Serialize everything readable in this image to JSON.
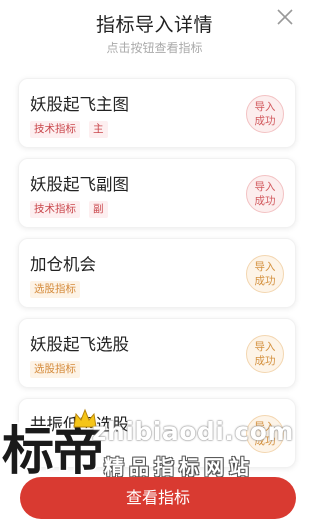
{
  "header": {
    "title": "指标导入详情",
    "subtitle": "点击按钮查看指标",
    "close_icon": "close-icon"
  },
  "items": [
    {
      "name": "妖股起飞主图",
      "tags": [
        "技术指标",
        "主"
      ],
      "tag_color": "red",
      "status": "导入成功"
    },
    {
      "name": "妖股起飞副图",
      "tags": [
        "技术指标",
        "副"
      ],
      "tag_color": "red",
      "status": "导入成功"
    },
    {
      "name": "加仓机会",
      "tags": [
        "选股指标"
      ],
      "tag_color": "orange",
      "status": "导入成功"
    },
    {
      "name": "妖股起飞选股",
      "tags": [
        "选股指标"
      ],
      "tag_color": "orange",
      "status": "导入成功"
    },
    {
      "name": "共振低吸选股",
      "tags": [],
      "tag_color": "orange",
      "status": "导入成功"
    }
  ],
  "watermark": {
    "brand": "标帝",
    "domain": "zhibiaodi.com",
    "slogan": "精品指标网站"
  },
  "footer": {
    "button_label": "查看指标"
  },
  "colors": {
    "accent": "#d93a31",
    "tag_red_bg": "#fdeff0",
    "tag_red_text": "#c9474c",
    "tag_orange_bg": "#fdf3e6",
    "tag_orange_text": "#d48a3a"
  }
}
